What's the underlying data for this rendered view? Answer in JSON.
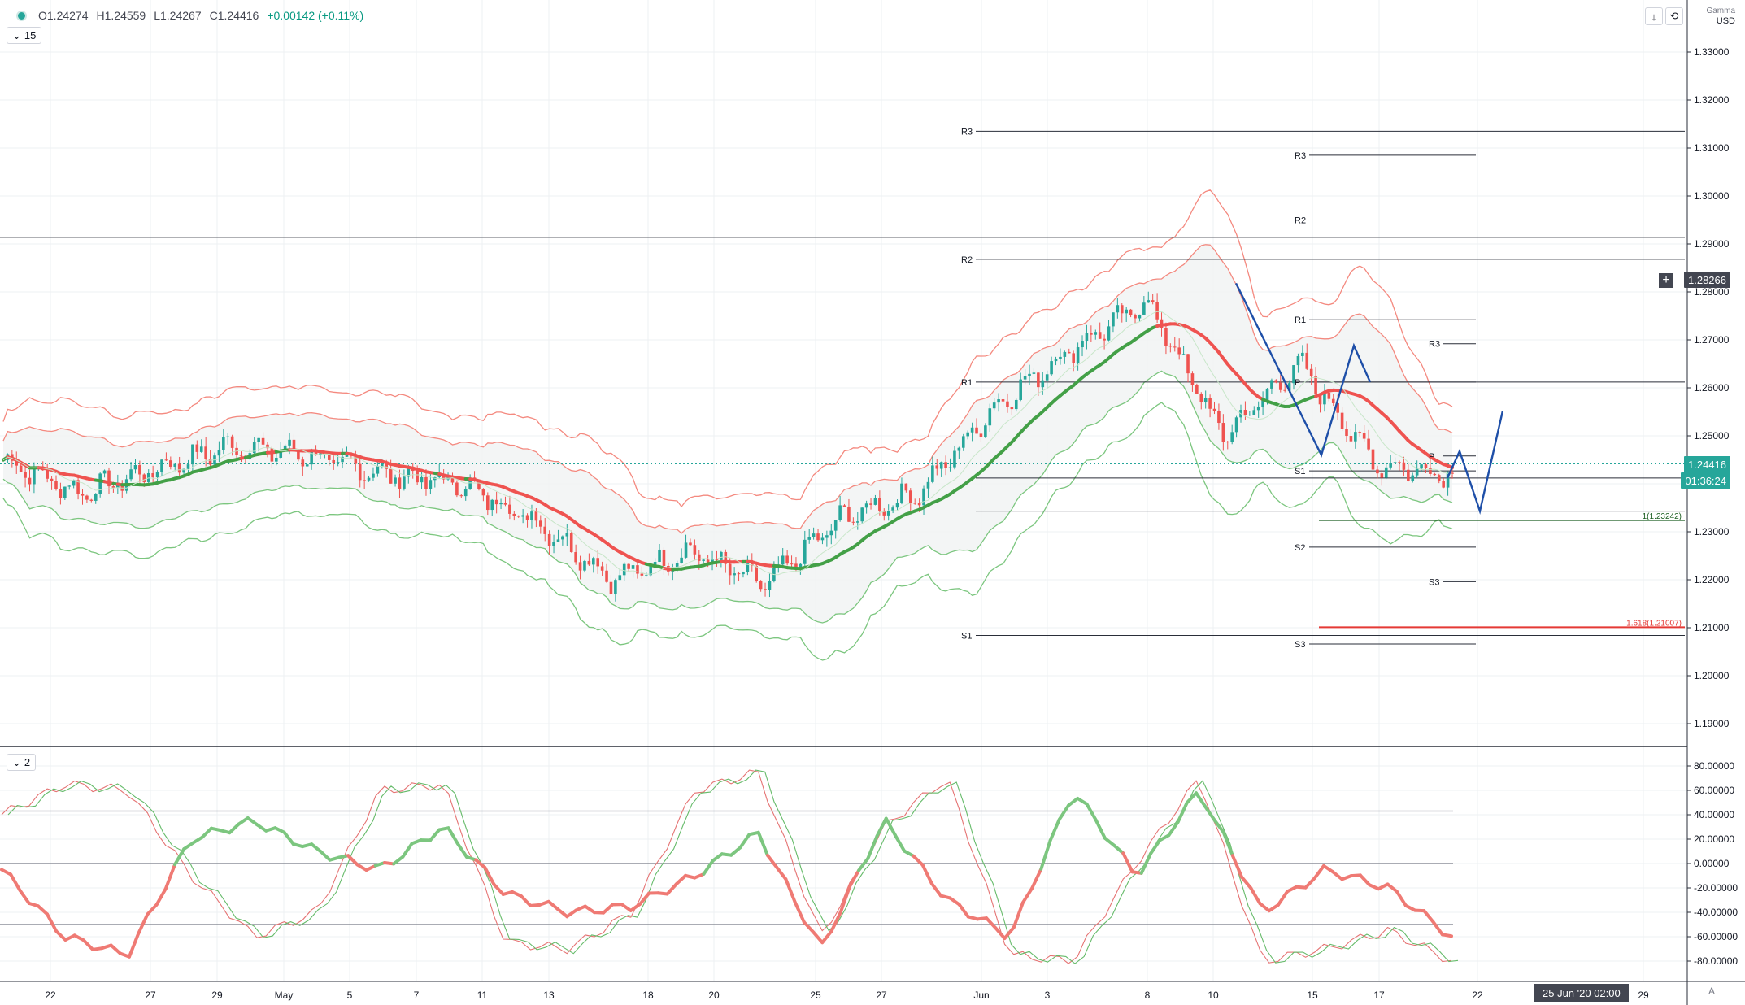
{
  "header": {
    "open": "O1.24274",
    "high": "H1.24559",
    "low": "L1.24267",
    "close": "C1.24416",
    "change": "+0.00142 (+0.11%)",
    "interval": "15",
    "oscillator_badge": "2",
    "currency": "USD",
    "currency_top": "Gamma"
  },
  "price_axis": {
    "ticks": [
      "1.33000",
      "1.32000",
      "1.31000",
      "1.30000",
      "1.29000",
      "1.28000",
      "1.27000",
      "1.26000",
      "1.25000",
      "1.24000",
      "1.23000",
      "1.22000",
      "1.21000",
      "1.20000",
      "1.19000"
    ],
    "last_price": "1.24416",
    "countdown": "01:36:24",
    "crosshair_price": "1.28266",
    "colors": {
      "last_price_bg": "#26a69a",
      "countdown_bg": "#26a69a",
      "crosshair_bg": "#434651"
    }
  },
  "osc_axis": {
    "ticks": [
      "80.00000",
      "60.00000",
      "40.00000",
      "20.00000",
      "0.00000",
      "-20.00000",
      "-40.00000",
      "-60.00000",
      "-80.00000"
    ]
  },
  "time_axis": {
    "ticks": [
      "22",
      "27",
      "29",
      "May",
      "5",
      "7",
      "11",
      "13",
      "18",
      "20",
      "25",
      "27",
      "Jun",
      "3",
      "8",
      "10",
      "15",
      "17",
      "22",
      "29"
    ],
    "cursor_date": "25 Jun '20  02:00",
    "corner": "A"
  },
  "annotations": {
    "pivot_labels": [
      "R3",
      "R2",
      "R1",
      "S1",
      "R3",
      "R2",
      "R1",
      "P",
      "S1",
      "S2",
      "S3",
      "R3",
      "P",
      "S3"
    ],
    "fib_1": "1(1.23242)",
    "fib_1618": "1.618(1.21007)"
  },
  "chart_data": [
    {
      "type": "line",
      "title": "",
      "xlabel": "",
      "ylabel": "",
      "ylim": [
        1.185,
        1.343
      ],
      "x": [
        "22",
        "27",
        "29",
        "May",
        "5",
        "7",
        "11",
        "13",
        "18",
        "20",
        "25",
        "27",
        "Jun",
        "3",
        "8",
        "10",
        "15",
        "17",
        "22",
        "29"
      ],
      "series": [
        {
          "name": "",
          "values": [
            1.245,
            1.238,
            1.243,
            1.248,
            1.246,
            1.242,
            1.24,
            1.232,
            1.22,
            1.226,
            1.219,
            1.233,
            1.238,
            1.256,
            1.268,
            1.278,
            1.25,
            1.265,
            1.244,
            1.242
          ]
        }
      ],
      "horizontal_levels": [
        1.3135,
        1.2868,
        1.2612,
        1.2412,
        1.2343,
        1.2084,
        1.2914
      ],
      "colors": {
        "up": "#26a69a",
        "down": "#ef5350",
        "ma_fast": "#4caf50",
        "ma_slow": "#ef5350",
        "band_upper": "#f4897f",
        "band_lower": "#7cc67f",
        "projection": "#1e4fa8"
      },
      "grid": true
    },
    {
      "type": "line",
      "title": "",
      "ylim": [
        -85,
        85
      ],
      "series": [
        {
          "name": "",
          "values": [
            -5,
            -60,
            -75,
            20,
            35,
            10,
            -5,
            30,
            -25,
            -40,
            -35,
            -10,
            25,
            -70,
            35,
            -30,
            -60,
            60,
            -10,
            60,
            -40,
            -5,
            -20,
            -60
          ]
        },
        {
          "name": "",
          "values": [
            40,
            65,
            60,
            -10,
            -60,
            -40,
            60,
            65,
            -65,
            -70,
            -40,
            60,
            75,
            -60,
            30,
            70,
            -75,
            -80,
            0,
            70,
            -80,
            -70,
            -55,
            -80
          ]
        }
      ],
      "levels": [
        0,
        43,
        -50
      ],
      "grid": true
    }
  ]
}
